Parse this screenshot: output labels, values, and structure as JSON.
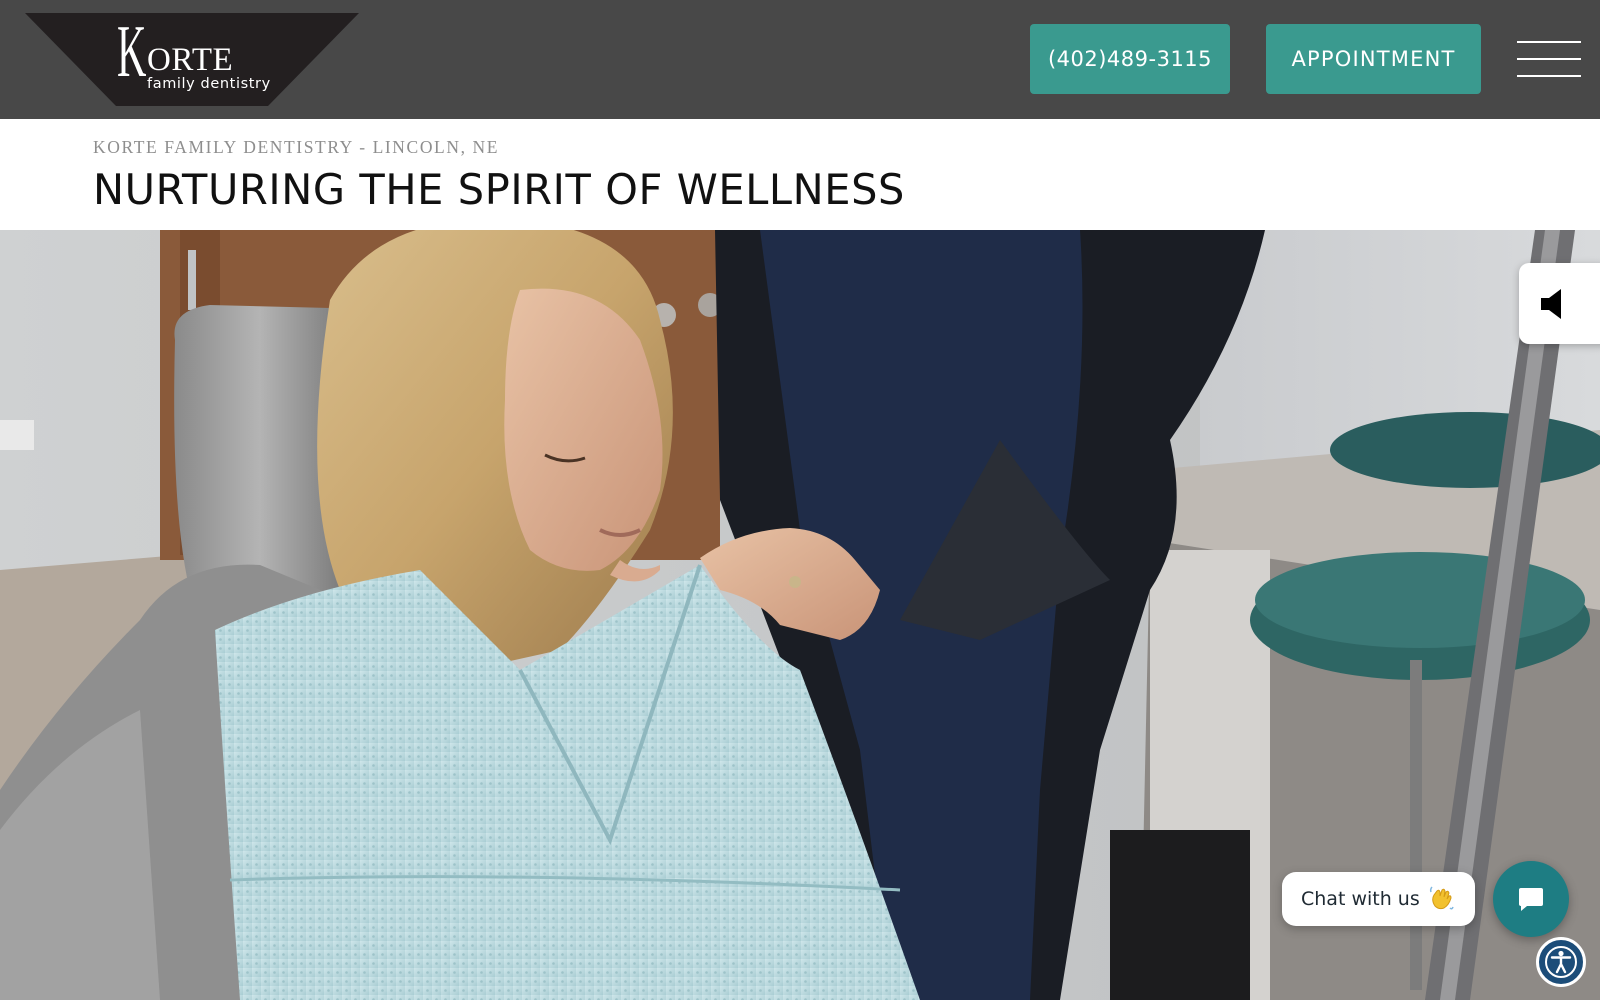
{
  "header": {
    "logo": {
      "initial": "K",
      "name": "ORTE",
      "tagline": "family dentistry"
    },
    "phone_label": "(402)489-3115",
    "appointment_label": "APPOINTMENT",
    "menu_icon": "hamburger-menu-icon"
  },
  "intro": {
    "eyebrow": "KORTE FAMILY DENTISTRY - LINCOLN, NE",
    "headline": "NURTURING THE SPIRIT OF WELLNESS"
  },
  "hero": {
    "scene": "patient-in-dental-chair-with-bib",
    "video_mute_icon": "speaker-mute-icon"
  },
  "chat": {
    "bubble_label": "Chat with us",
    "wave_icon": "waving-hand-icon",
    "launcher_icon": "chat-icon"
  },
  "accessibility": {
    "icon": "accessibility-icon"
  },
  "colors": {
    "header_bg": "#484848",
    "accent_teal": "#3a9a8f",
    "chat_teal": "#1e7d83",
    "a11y_blue": "#1c4d79"
  }
}
